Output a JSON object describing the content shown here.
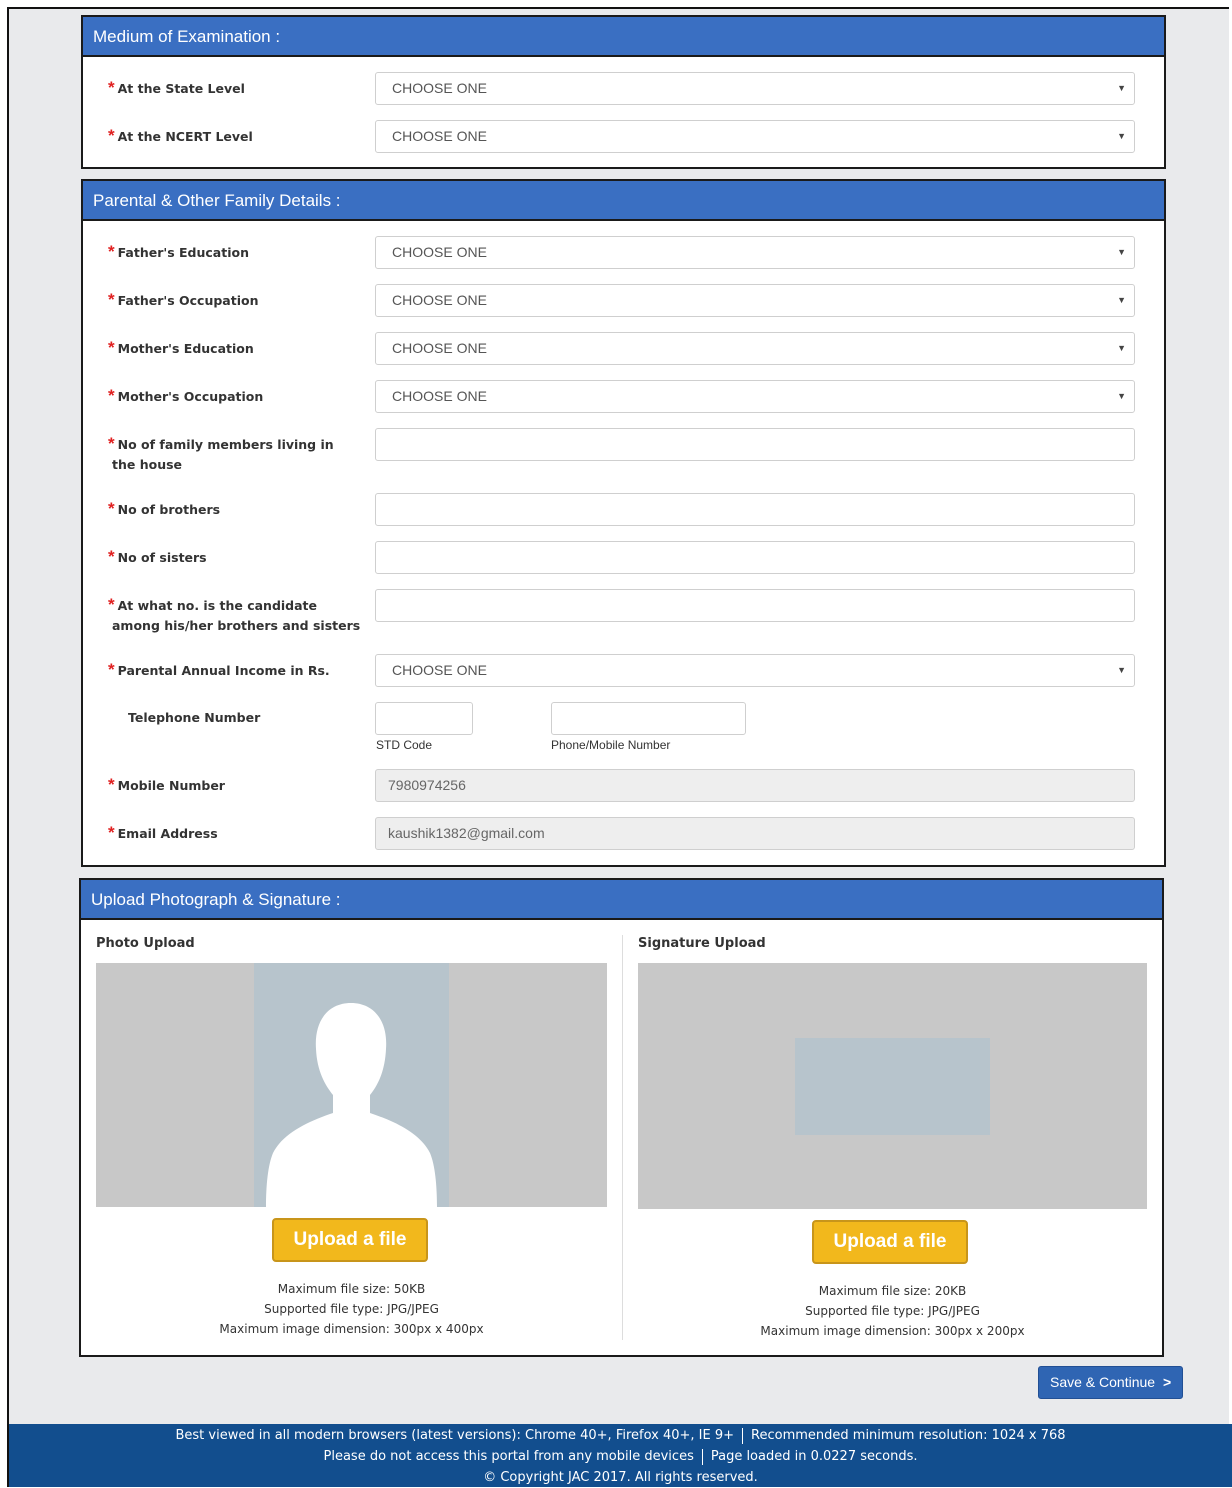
{
  "medium": {
    "title": "Medium of Examination :",
    "state_label": "At the State Level",
    "state_value": "CHOOSE ONE",
    "ncert_label": "At the NCERT Level",
    "ncert_value": "CHOOSE ONE"
  },
  "parental": {
    "title": "Parental & Other Family Details :",
    "father_edu_label": "Father's Education",
    "father_edu_value": "CHOOSE ONE",
    "father_occ_label": "Father's Occupation",
    "father_occ_value": "CHOOSE ONE",
    "mother_edu_label": "Mother's Education",
    "mother_edu_value": "CHOOSE ONE",
    "mother_occ_label": "Mother's Occupation",
    "mother_occ_value": "CHOOSE ONE",
    "family_members_label_1": "No of family members living in",
    "family_members_label_2": "the house",
    "brothers_label": "No of brothers",
    "sisters_label": "No of sisters",
    "position_label_1": "At what no. is the candidate",
    "position_label_2": "among his/her brothers and sisters",
    "income_label": "Parental Annual Income in Rs.",
    "income_value": "CHOOSE ONE",
    "telephone_label": "Telephone Number",
    "std_code_caption": "STD Code",
    "phone_caption": "Phone/Mobile Number",
    "mobile_label": "Mobile Number",
    "mobile_value": "7980974256",
    "email_label": "Email Address",
    "email_value": "kaushik1382@gmail.com"
  },
  "upload": {
    "title": "Upload Photograph & Signature :",
    "photo_title": "Photo Upload",
    "photo_button": "Upload a file",
    "photo_info_1": "Maximum file size: 50KB",
    "photo_info_2": "Supported file type: JPG/JPEG",
    "photo_info_3": "Maximum image dimension: 300px x 400px",
    "sign_title": "Signature Upload",
    "sign_button": "Upload a file",
    "sign_info_1": "Maximum file size: 20KB",
    "sign_info_2": "Supported file type: JPG/JPEG",
    "sign_info_3": "Maximum image dimension: 300px x 200px"
  },
  "actions": {
    "save_label": "Save & Continue"
  },
  "footer": {
    "line1_a": "Best viewed in all modern browsers (latest versions): Chrome 40+, Firefox 40+, IE 9+",
    "line1_b": "Recommended minimum resolution: 1024 x 768",
    "line2_a": "Please do not access this portal from any mobile devices",
    "line2_b": "Page loaded in 0.0227 seconds.",
    "line3": "© Copyright JAC 2017. All rights reserved."
  },
  "colors": {
    "header_blue": "#3a6fc2",
    "upload_yellow": "#f2b81c",
    "footer_blue": "#124e8e",
    "required_red": "#e02020"
  }
}
